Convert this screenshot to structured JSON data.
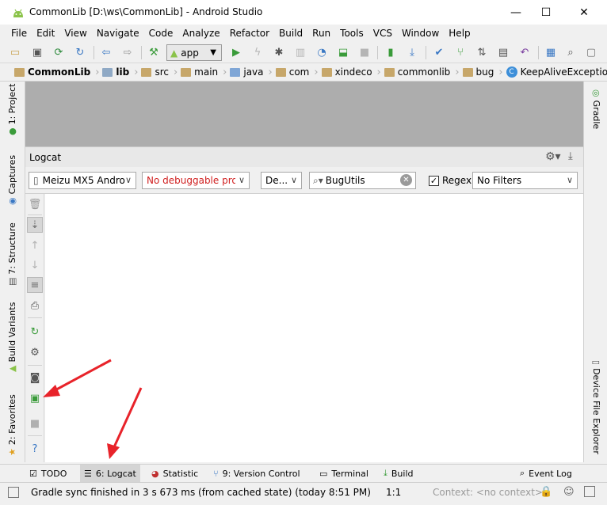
{
  "window": {
    "title": "CommonLib [D:\\ws\\CommonLib] - Android Studio",
    "min_symbol": "—",
    "max_symbol": "☐",
    "close_symbol": "✕"
  },
  "menu": [
    "File",
    "Edit",
    "View",
    "Navigate",
    "Code",
    "Analyze",
    "Refactor",
    "Build",
    "Run",
    "Tools",
    "VCS",
    "Window",
    "Help"
  ],
  "toolbar": {
    "run_config": "app",
    "icons": [
      "open-icon",
      "save-icon",
      "sync-icon",
      "refresh-icon",
      "back-icon",
      "forward-icon",
      "make-icon",
      "run-icon",
      "apply-changes-icon",
      "debug-icon",
      "profile-icon",
      "attach-icon",
      "stop-icon",
      "avd-icon",
      "sdk-icon",
      "gradle-sync-icon",
      "layout-inspector-icon",
      "vcs-icon",
      "undo-icon",
      "project-structure-icon",
      "search-icon",
      "window-icon"
    ]
  },
  "breadcrumbs": [
    "CommonLib",
    "lib",
    "src",
    "main",
    "java",
    "com",
    "xindeco",
    "commonlib",
    "bug",
    "KeepAliveExceptionHandle"
  ],
  "left_tabs": [
    "1: Project",
    "Captures",
    "7: Structure",
    "Build Variants",
    "2: Favorites"
  ],
  "right_tabs": [
    "Gradle",
    "Device File Explorer"
  ],
  "logcat": {
    "title": "Logcat",
    "device": "Meizu MX5 Andro",
    "process": "No debuggable proc",
    "level": "De...",
    "search_value": "BugUtils",
    "regex_label": "Regex",
    "regex_checked": "✓",
    "filter": "No Filters"
  },
  "bottom_tabs": [
    {
      "label": "TODO",
      "icon": "todo-icon"
    },
    {
      "label": "6: Logcat",
      "icon": "logcat-icon",
      "active": true
    },
    {
      "label": "Statistic",
      "icon": "statistic-icon"
    },
    {
      "label": "9: Version Control",
      "icon": "vcs-icon"
    },
    {
      "label": "Terminal",
      "icon": "terminal-icon"
    },
    {
      "label": "Build",
      "icon": "build-icon"
    },
    {
      "label": "Event Log",
      "icon": "event-log-icon"
    }
  ],
  "status": {
    "message": "Gradle sync finished in 3 s 673 ms (from cached state) (today 8:51 PM)",
    "position": "1:1",
    "context": "Context: <no context>"
  },
  "colors": {
    "accent_red": "#e8232a",
    "process_red": "#d02020",
    "run_green": "#3a9b3a",
    "editor_gray": "#adadad"
  }
}
